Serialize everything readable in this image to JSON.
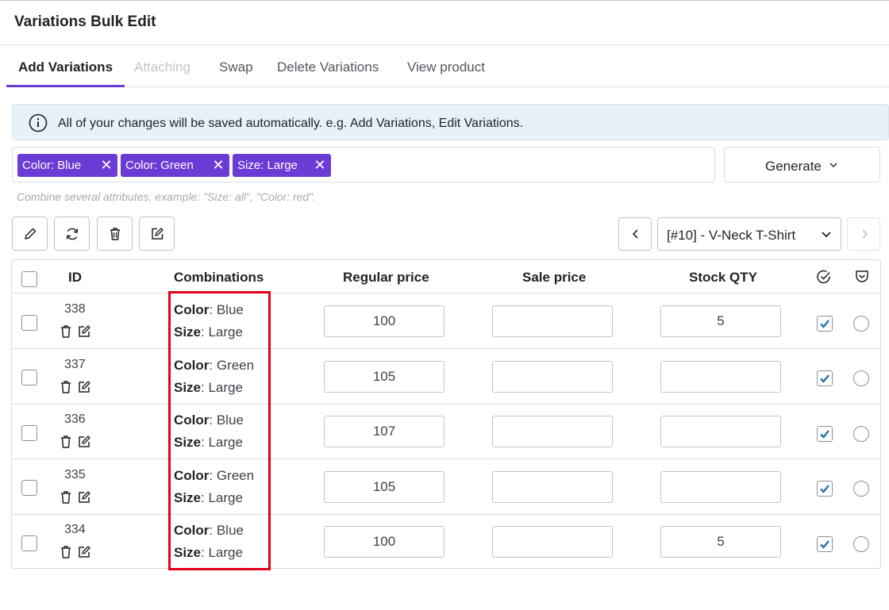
{
  "app": {
    "title": "Variations Bulk Edit"
  },
  "tabs": [
    {
      "label": "Add Variations",
      "state": "active"
    },
    {
      "label": "Attaching",
      "state": "disabled"
    },
    {
      "label": "Swap",
      "state": "normal"
    },
    {
      "label": "Delete Variations",
      "state": "normal"
    },
    {
      "label": "View product",
      "state": "normal"
    }
  ],
  "notice": {
    "text": "All of your changes will be saved automatically. e.g. Add Variations, Edit Variations.",
    "icon": "info-icon"
  },
  "attribute_tags": [
    {
      "label": "Color: Blue"
    },
    {
      "label": "Color: Green"
    },
    {
      "label": "Size: Large"
    }
  ],
  "generate": {
    "label": "Generate"
  },
  "hint": "Combine several attributes, example: \"Size: all\", \"Color: red\".",
  "toolbar": {
    "icons": [
      "pencil-icon",
      "refresh-icon",
      "trash-icon",
      "edit-square-icon"
    ]
  },
  "product_nav": {
    "selected": "[#10] - V-Neck T-Shirt"
  },
  "table": {
    "headers": {
      "id": "ID",
      "combinations": "Combinations",
      "regular_price": "Regular price",
      "sale_price": "Sale price",
      "stock_qty": "Stock QTY"
    },
    "rows": [
      {
        "id": "338",
        "color_key": "Color",
        "color_value": ": Blue",
        "size_key": "Size",
        "size_value": ": Large",
        "regular_price": "100",
        "sale_price": "",
        "stock_qty": "5",
        "enabled": true
      },
      {
        "id": "337",
        "color_key": "Color",
        "color_value": ": Green",
        "size_key": "Size",
        "size_value": ": Large",
        "regular_price": "105",
        "sale_price": "",
        "stock_qty": "",
        "enabled": true
      },
      {
        "id": "336",
        "color_key": "Color",
        "color_value": ": Blue",
        "size_key": "Size",
        "size_value": ": Large",
        "regular_price": "107",
        "sale_price": "",
        "stock_qty": "",
        "enabled": true
      },
      {
        "id": "335",
        "color_key": "Color",
        "color_value": ": Green",
        "size_key": "Size",
        "size_value": ": Large",
        "regular_price": "105",
        "sale_price": "",
        "stock_qty": "",
        "enabled": true
      },
      {
        "id": "334",
        "color_key": "Color",
        "color_value": ": Blue",
        "size_key": "Size",
        "size_value": ": Large",
        "regular_price": "100",
        "sale_price": "",
        "stock_qty": "5",
        "enabled": true
      }
    ]
  },
  "colors": {
    "accent": "#6b3bd6",
    "highlight": "#e3001b",
    "notice_bg": "#e8f0f8"
  }
}
